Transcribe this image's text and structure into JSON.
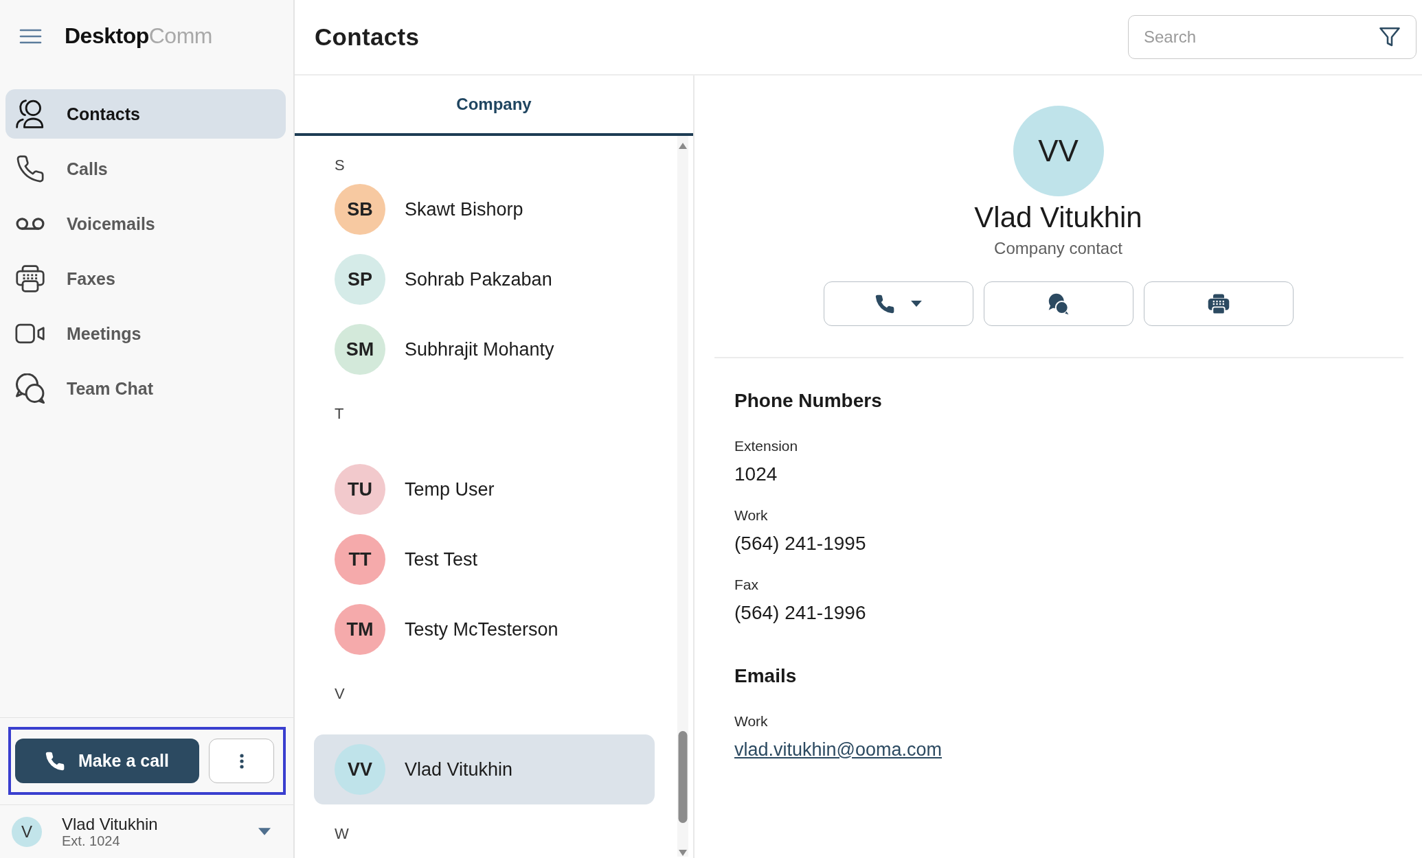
{
  "sidebar": {
    "logo": {
      "primary": "Desktop",
      "secondary": "Comm"
    },
    "nav": [
      {
        "label": "Contacts",
        "selected": true
      },
      {
        "label": "Calls",
        "selected": false
      },
      {
        "label": "Voicemails",
        "selected": false
      },
      {
        "label": "Faxes",
        "selected": false
      },
      {
        "label": "Meetings",
        "selected": false
      },
      {
        "label": "Team Chat",
        "selected": false
      }
    ],
    "call_bar": {
      "highlighted": true,
      "make_call_label": "Make a call"
    },
    "user": {
      "initial": "V",
      "name": "Vlad Vitukhin",
      "extension": "Ext. 1024"
    }
  },
  "header": {
    "title": "Contacts",
    "search": {
      "placeholder": "Search"
    }
  },
  "contact_list": {
    "tabs": [
      {
        "label": "Company",
        "selected": true
      }
    ],
    "sections": [
      {
        "letter": "S",
        "contacts": [
          {
            "initials": "SB",
            "name": "Skawt Bishorp",
            "color": "#f7c9a1",
            "selected": false
          },
          {
            "initials": "SP",
            "name": "Sohrab Pakzaban",
            "color": "#d5ebe8",
            "selected": false
          },
          {
            "initials": "SM",
            "name": "Subhrajit Mohanty",
            "color": "#d3e9da",
            "selected": false
          }
        ]
      },
      {
        "letter": "T",
        "contacts": [
          {
            "initials": "TU",
            "name": "Temp User",
            "color": "#f2c9cc",
            "selected": false
          },
          {
            "initials": "TT",
            "name": "Test Test",
            "color": "#f5aaab",
            "selected": false
          },
          {
            "initials": "TM",
            "name": "Testy McTesterson",
            "color": "#f5aaab",
            "selected": false
          }
        ]
      },
      {
        "letter": "V",
        "contacts": [
          {
            "initials": "VV",
            "name": "Vlad Vitukhin",
            "color": "#bfe3ea",
            "selected": true
          }
        ]
      },
      {
        "letter": "W"
      }
    ]
  },
  "contact_detail": {
    "initials": "VV",
    "name": "Vlad Vitukhin",
    "subtitle": "Company contact",
    "phone_numbers": {
      "heading": "Phone Numbers",
      "entries": [
        {
          "label": "Extension",
          "value": "1024"
        },
        {
          "label": "Work",
          "value": "(564) 241-1995"
        },
        {
          "label": "Fax",
          "value": "(564) 241-1996"
        }
      ]
    },
    "emails": {
      "heading": "Emails",
      "entries": [
        {
          "label": "Work",
          "value": "vlad.vitukhin@ooma.com"
        }
      ]
    }
  }
}
